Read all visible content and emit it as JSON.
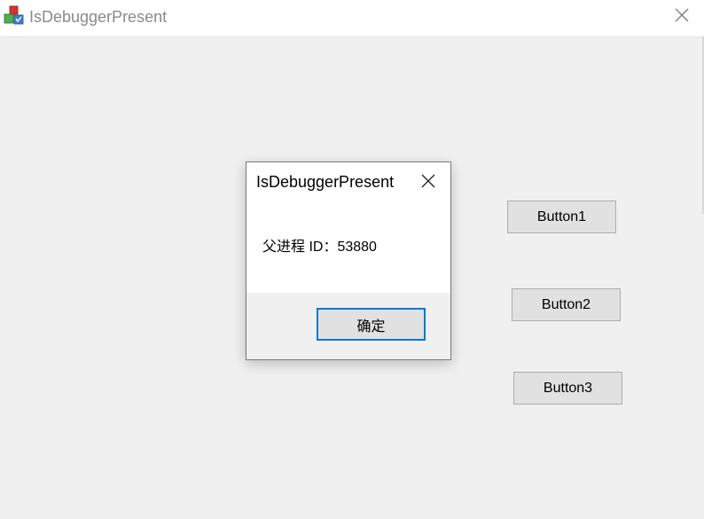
{
  "window": {
    "title": "IsDebuggerPresent",
    "app_icon": "colored-cubes-icon",
    "close_icon": "close-icon"
  },
  "buttons": {
    "button1": "Button1",
    "button2": "Button2",
    "button3": "Button3"
  },
  "dialog": {
    "title": "IsDebuggerPresent",
    "message": "父进程 ID：53880",
    "ok_label": "确定",
    "close_icon": "close-icon",
    "accent_color": "#0078d7"
  }
}
